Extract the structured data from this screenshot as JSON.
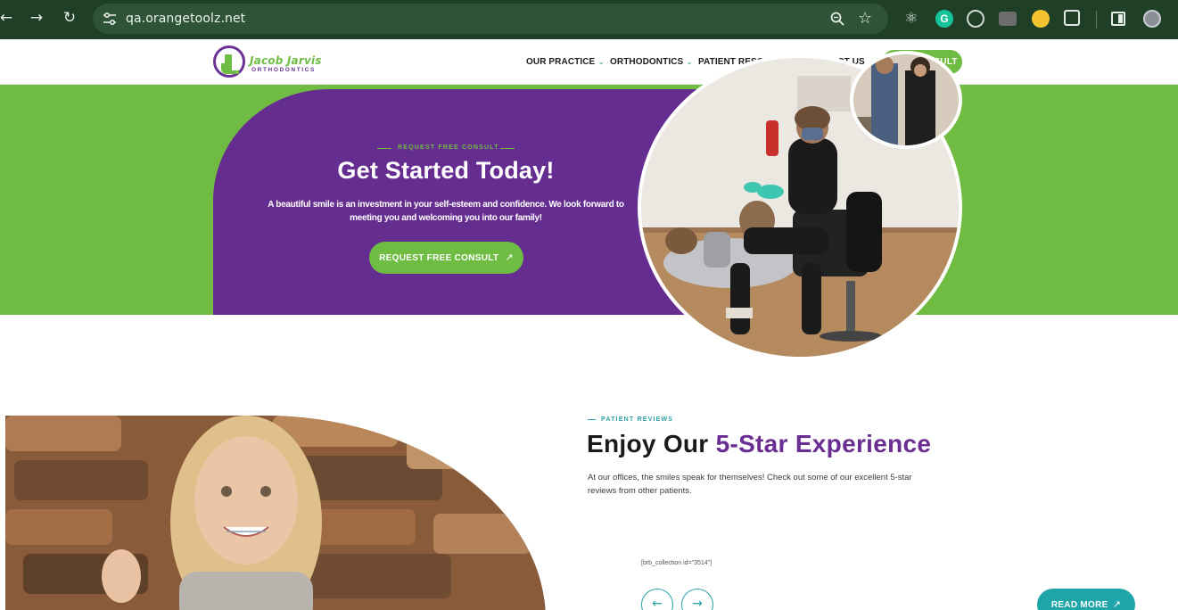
{
  "browser": {
    "url": "qa.orangetoolz.net",
    "nav_back_glyph": "←",
    "nav_forward_glyph": "→",
    "nav_reload_glyph": "↻",
    "star_glyph": "☆",
    "react_glyph": "⚛",
    "grammarly_glyph": "G"
  },
  "logo": {
    "name": "Jacob Jarvis",
    "sub": "ORTHODONTICS"
  },
  "nav": {
    "items": [
      {
        "label": "OUR PRACTICE",
        "chevron": "⌄"
      },
      {
        "label": "ORTHODONTICS",
        "chevron": "⌄"
      },
      {
        "label": "PATIENT RESOURCES",
        "chevron": "⌄"
      },
      {
        "label": "CONTACT US",
        "chevron": "⌄"
      }
    ],
    "cta_label": "FREE CONSULT"
  },
  "hero": {
    "eyebrow": "REQUEST FREE CONSULT",
    "title": "Get Started Today!",
    "text": "A beautiful smile is an investment in your self-esteem and confidence. We look forward to meeting you and welcoming you into our family!",
    "button_label": "REQUEST FREE CONSULT",
    "button_arrow": "↗"
  },
  "reviews": {
    "eyebrow": "PATIENT REVIEWS",
    "title_plain": "Enjoy Our ",
    "title_accent": "5-Star Experience",
    "text": "At our offices, the smiles speak for themselves! Check out some of our excellent 5-star reviews from other patients.",
    "shortcode": "[brb_collection id=\"3514\"]",
    "prev_glyph": "←",
    "next_glyph": "→",
    "read_more_label": "READ MORE",
    "read_more_arrow": "↗"
  },
  "colors": {
    "green": "#70bc42",
    "purple": "#662d91",
    "teal": "#1ea5a8",
    "chrome": "#1f3f27"
  }
}
